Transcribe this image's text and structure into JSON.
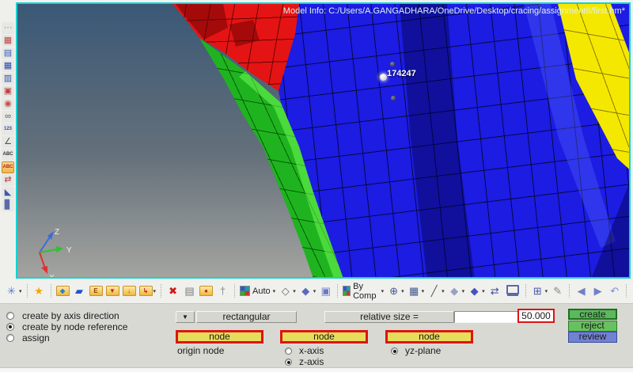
{
  "window": {
    "model_info": "Model Info: C:/Users/A.GANGADHARA/OneDrive/Desktop/cracing/assignment6/first.hm*"
  },
  "viewport": {
    "node_label": "174247",
    "triad": {
      "x": "X",
      "y": "Y",
      "z": "Z"
    },
    "colors": {
      "border_teal": "#14d2d2",
      "mesh_blue": "#1c1ce2",
      "mesh_blue_dark": "#12129e",
      "mesh_green": "#1fb41f",
      "mesh_green_bright": "#3ce63c",
      "mesh_red": "#e41414",
      "mesh_red_dark": "#9e0e0e",
      "mesh_yellow": "#f5e800",
      "bg_top": "#3a5876",
      "bg_bottom": "#a4a4a0"
    }
  },
  "sidebar": {
    "icons": [
      {
        "name": "drag-handle",
        "glyph": "⋯",
        "color": "#9a9a9a"
      },
      {
        "name": "panel-window",
        "glyph": "▦",
        "color": "#b84444"
      },
      {
        "name": "mask-panel",
        "glyph": "▤",
        "color": "#3a5ab0"
      },
      {
        "name": "model-browser",
        "glyph": "▦",
        "color": "#2c49a8"
      },
      {
        "name": "solver-browser",
        "glyph": "▥",
        "color": "#2c49a8"
      },
      {
        "name": "entity-sets",
        "glyph": "▣",
        "color": "#b84444"
      },
      {
        "name": "spherical-clip",
        "glyph": "◉",
        "color": "#c05050"
      },
      {
        "name": "find-binoculars",
        "glyph": "∞",
        "color": "#555555"
      },
      {
        "name": "numbers-display",
        "glyph": "123",
        "color": "#2c49a8"
      },
      {
        "name": "measure-tool",
        "glyph": "∠",
        "color": "#555555"
      },
      {
        "name": "label-grid",
        "glyph": "ABC",
        "color": "#333333"
      },
      {
        "name": "label-active",
        "glyph": "ABC",
        "color": "#b02020",
        "selected": true
      },
      {
        "name": "transform-arrows",
        "glyph": "⇄",
        "color": "#b04040"
      },
      {
        "name": "banner-flag",
        "glyph": "◣",
        "color": "#3a5ab0"
      },
      {
        "name": "material-jar",
        "glyph": "▊",
        "color": "#5a6aa8"
      }
    ]
  },
  "toolbar": {
    "items": [
      {
        "name": "settings-gear",
        "glyph": "✳",
        "color": "#4d7fd0",
        "caret": true
      },
      {
        "type": "sep"
      },
      {
        "name": "favorites-star",
        "glyph": "★",
        "color": "#f0a800"
      },
      {
        "type": "sep"
      },
      {
        "name": "import-model",
        "folder": true,
        "glyph": "◆",
        "color": "#2d7dd2"
      },
      {
        "name": "open-model",
        "glyph": "▰",
        "color": "#2255cc"
      },
      {
        "name": "export-model",
        "folder": true,
        "glyph": "E",
        "color": "#884400"
      },
      {
        "name": "save-model",
        "folder": true,
        "glyph": "▼",
        "color": "#cc2222"
      },
      {
        "name": "save-as-model",
        "folder": true,
        "glyph": "↓",
        "color": "#cc2222"
      },
      {
        "name": "recent-files",
        "folder": true,
        "glyph": "↳",
        "color": "#cc2222",
        "caret": true
      },
      {
        "type": "sep"
      },
      {
        "name": "delete-entity",
        "glyph": "✖",
        "color": "#cc1818"
      },
      {
        "name": "reorder-layers",
        "glyph": "▤",
        "color": "#787878"
      },
      {
        "name": "organize",
        "folder": true,
        "glyph": "●",
        "color": "#cc2222"
      },
      {
        "name": "walkthrough",
        "glyph": "†",
        "color": "#888888"
      },
      {
        "type": "sep"
      },
      {
        "name": "auto-color-mode",
        "swatch": true,
        "label": "Auto",
        "caret": true
      },
      {
        "name": "selector-outline",
        "glyph": "◇",
        "color": "#666666",
        "caret": true
      },
      {
        "name": "selector-filled",
        "glyph": "◆",
        "color": "#5a6abf",
        "caret": true
      },
      {
        "name": "view-cube",
        "glyph": "▣",
        "color": "#6a79c8"
      },
      {
        "type": "sep"
      },
      {
        "name": "color-by-comp",
        "swatch": true,
        "label": "By Comp",
        "caret": true
      },
      {
        "name": "wireframe-mode",
        "glyph": "⊕",
        "color": "#46588e",
        "caret": true
      },
      {
        "name": "shaded-mode",
        "glyph": "▦",
        "color": "#46588e",
        "caret": true
      },
      {
        "name": "edge-display",
        "glyph": "╱",
        "color": "#555555",
        "caret": true
      },
      {
        "name": "feature-display",
        "glyph": "◆",
        "color": "#9aa0c0",
        "caret": true
      },
      {
        "name": "shrink-display",
        "glyph": "◆",
        "color": "#4653b8",
        "caret": true
      },
      {
        "name": "fit-view",
        "glyph": "⇄",
        "color": "#3a4a9a"
      },
      {
        "name": "full-screen",
        "monitor": true
      },
      {
        "type": "sep"
      },
      {
        "name": "window-layout",
        "glyph": "⊞",
        "color": "#4a5aa8",
        "caret": true
      },
      {
        "name": "preferences-wrench",
        "glyph": "✎",
        "color": "#888888"
      },
      {
        "type": "sep"
      },
      {
        "name": "view-prev",
        "glyph": "◀",
        "color": "#7080c8"
      },
      {
        "name": "view-next",
        "glyph": "▶",
        "color": "#7080c8"
      },
      {
        "name": "view-undo",
        "glyph": "↶",
        "color": "#8090c8"
      },
      {
        "type": "sep"
      },
      {
        "name": "zoom-out",
        "glyph": "−",
        "color": "#333333"
      },
      {
        "name": "zoom-in",
        "glyph": "+",
        "color": "#333333"
      },
      {
        "name": "view-redo",
        "glyph": "↷",
        "color": "#8090c8"
      }
    ]
  },
  "panel": {
    "mode_radios": [
      {
        "label": "create by axis direction",
        "selected": false
      },
      {
        "label": "create by node reference",
        "selected": true
      },
      {
        "label": "assign",
        "selected": false
      }
    ],
    "dropdown_arrow": "▼",
    "shape_type": "rectangular",
    "relative_size_label": "relative size =",
    "relative_size_value": "50.000",
    "actions": [
      {
        "label": "create",
        "bg": "#5cb85c",
        "border": "#1e6e1e"
      },
      {
        "label": "reject",
        "bg": "#66c25f",
        "border": "#2f7a2f"
      },
      {
        "label": "review",
        "bg": "#7282d2",
        "border": "#3a4a9a"
      }
    ],
    "origin_selector": {
      "button": "node",
      "caption": "origin node"
    },
    "axis_selector": {
      "button": "node",
      "radios": [
        {
          "label": "x-axis",
          "selected": false
        },
        {
          "label": "z-axis",
          "selected": true
        }
      ]
    },
    "plane_selector": {
      "button": "node",
      "radios": [
        {
          "label": "yz-plane",
          "selected": true
        }
      ]
    }
  }
}
